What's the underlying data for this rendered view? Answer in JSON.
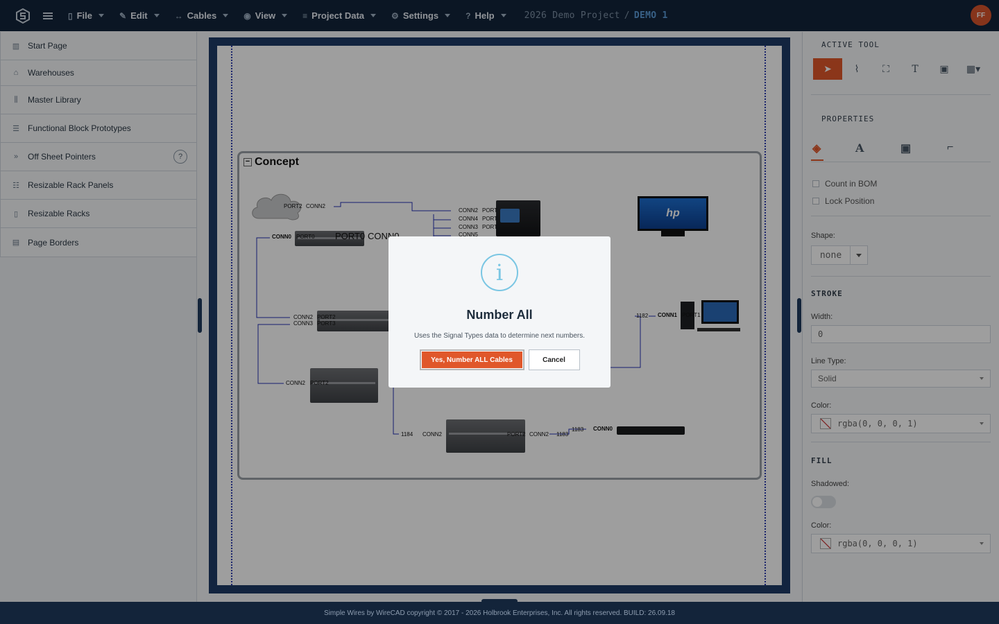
{
  "menu": {
    "file": "File",
    "edit": "Edit",
    "cables": "Cables",
    "view": "View",
    "project_data": "Project Data",
    "settings": "Settings",
    "help": "Help"
  },
  "project": {
    "name": "2026 Demo Project",
    "separator": "/",
    "page": "DEMO 1"
  },
  "user": {
    "initials": "FF"
  },
  "sidebar": {
    "items": [
      {
        "label": "Start Page",
        "icon": "columns-icon"
      },
      {
        "label": "Warehouses",
        "icon": "warehouse-icon"
      },
      {
        "label": "Master Library",
        "icon": "library-icon"
      },
      {
        "label": "Functional Block Prototypes",
        "icon": "layers-icon"
      },
      {
        "label": "Off Sheet Pointers",
        "icon": "chevrons-right-icon",
        "help": "?"
      },
      {
        "label": "Resizable Rack Panels",
        "icon": "rack-panels-icon"
      },
      {
        "label": "Resizable Racks",
        "icon": "rack-icon"
      },
      {
        "label": "Page Borders",
        "icon": "page-border-icon"
      }
    ]
  },
  "canvas": {
    "group_title": "Concept",
    "labels": {
      "port2a": "PORT2",
      "conn2a": "CONN2",
      "conn0a": "CONN0",
      "port0a": "PORT0",
      "port0b": "PORT0",
      "conn0b": "CONN0",
      "conn2b": "CONN2",
      "porta": "PORT",
      "conn4": "CONN4",
      "portb": "PORT",
      "conn3a": "CONN3",
      "portc": "PORT",
      "conn5": "CONN5",
      "conn2c": "CONN2",
      "port2b": "PORT2",
      "conn3b": "CONN3",
      "port3": "PORT3",
      "conn2d": "CONN2",
      "port2c": "PORT2",
      "n1182": "1182",
      "conn1": "CONN1",
      "port1": "PORT1",
      "n1184": "1184",
      "conn2e": "CONN2",
      "port2d": "PORT2",
      "conn2f": "CONN2",
      "n1183a": "1183",
      "n1183b": "1183",
      "conn0c": "CONN0",
      "monitor_logo": "hp"
    }
  },
  "right_panel": {
    "active_tool_heading": "ACTIVE TOOL",
    "properties_heading": "PROPERTIES",
    "tools": [
      "pointer-icon",
      "bezier-icon",
      "nodes-icon",
      "text-icon",
      "image-icon",
      "grid-add-icon"
    ],
    "count_in_bom": "Count in BOM",
    "lock_position": "Lock Position",
    "shape_label": "Shape:",
    "shape_value": "none",
    "stroke_heading": "STROKE",
    "width_label": "Width:",
    "width_value": "0",
    "line_type_label": "Line Type:",
    "line_type_value": "Solid",
    "stroke_color_label": "Color:",
    "stroke_color_value": "rgba(0, 0, 0, 1)",
    "fill_heading": "FILL",
    "shadowed_label": "Shadowed:",
    "fill_color_label": "Color:",
    "fill_color_value": "rgba(0, 0, 0, 1)"
  },
  "modal": {
    "icon": "i",
    "title": "Number All",
    "text": "Uses the Signal Types data to determine next numbers.",
    "confirm": "Yes, Number ALL Cables",
    "cancel": "Cancel"
  },
  "footer": {
    "text": "Simple Wires by WireCAD copyright © 2017 - 2026 Holbrook Enterprises, Inc. All rights reserved. BUILD: 26.09.18"
  },
  "colors": {
    "topbar": "#13243a",
    "accent": "#e0572a",
    "page_border": "#1d3b66",
    "info_icon": "#7ac6e3"
  }
}
